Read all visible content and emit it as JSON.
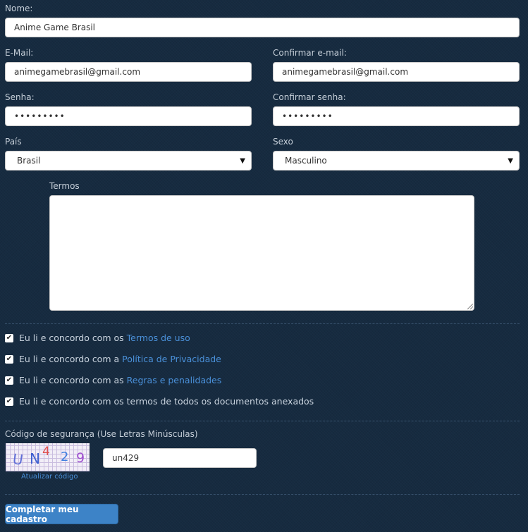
{
  "form": {
    "nome": {
      "label": "Nome:",
      "value": "Anime Game Brasil"
    },
    "email": {
      "label": "E-Mail:",
      "value": "animegamebrasil@gmail.com"
    },
    "confirm_email": {
      "label": "Confirmar e-mail:",
      "value": "animegamebrasil@gmail.com"
    },
    "senha": {
      "label": "Senha:",
      "value": "•••••••••"
    },
    "confirm_senha": {
      "label": "Confirmar senha:",
      "value": "•••••••••"
    },
    "pais": {
      "label": "País",
      "value": "Brasil"
    },
    "sexo": {
      "label": "Sexo",
      "value": "Masculino"
    },
    "termos": {
      "label": "Termos"
    }
  },
  "checks": [
    {
      "prefix": "Eu li e concordo com os",
      "link": "Termos de uso",
      "checked": true
    },
    {
      "prefix": "Eu li e concordo com a",
      "link": "Política de Privacidade",
      "checked": true
    },
    {
      "prefix": "Eu li e concordo com as",
      "link": "Regras e penalidades",
      "checked": true
    },
    {
      "prefix": "Eu li e concordo com os termos de todos os documentos anexados",
      "link": "",
      "checked": true
    }
  ],
  "security": {
    "label": "Código de segurança (Use Letras Minúsculas)",
    "captcha_chars": [
      "U",
      "N",
      "4",
      "2",
      "9"
    ],
    "captcha_colors": [
      "#5f6fd8",
      "#3f5fd0",
      "#e05050",
      "#3f7fe0",
      "#a050d0"
    ],
    "input_value": "un429",
    "refresh_label": "Atualizar código"
  },
  "submit_label": "Completar meu cadastro",
  "check_glyph": "✔",
  "select_arrow": "▼"
}
